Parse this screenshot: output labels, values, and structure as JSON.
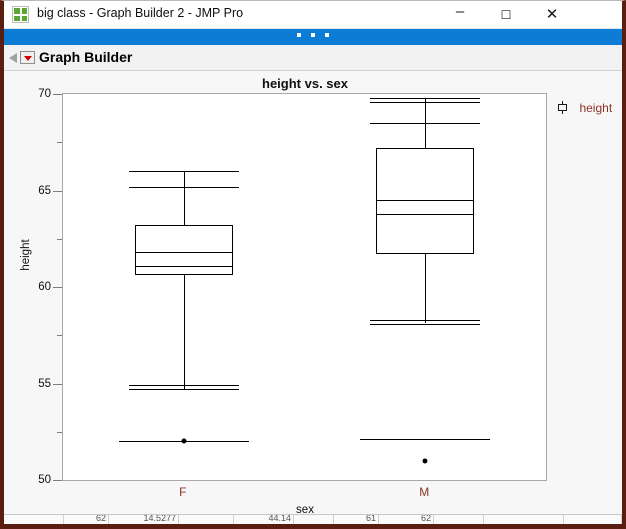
{
  "window": {
    "title": "big class - Graph Builder 2 - JMP Pro",
    "app_icon": "jmp-grid-icon",
    "minimize_label": "–",
    "maximize_label": "☐",
    "close_label": "✕"
  },
  "toolbar": {
    "handle_label": "toolbar-handle-dots"
  },
  "report": {
    "title": "Graph Builder",
    "menu_icon": "red-triangle-menu-icon",
    "disclosure_icon": "disclosure-triangle-icon"
  },
  "legend": {
    "label": "height",
    "icon": "boxplot-legend-icon",
    "color": "#8a3324"
  },
  "colors": {
    "axis_label": "#8a3324",
    "frame": "#a8a8a8",
    "titlebar_accent": "#0c7cd5",
    "window_border": "#5a1e10",
    "plot_background": "#ffffff"
  },
  "bottom_table": {
    "cells": [
      "",
      "62",
      "14.5277",
      "",
      "44.14",
      "",
      "61",
      "62",
      "",
      "",
      ""
    ]
  },
  "chart_data": {
    "type": "box",
    "title": "height vs. sex",
    "xlabel": "sex",
    "ylabel": "height",
    "ylim": [
      50,
      70
    ],
    "ytick_major": [
      50,
      55,
      60,
      65,
      70
    ],
    "ytick_minor": [
      52.5,
      57.5,
      62.5,
      67.5
    ],
    "categories": [
      "F",
      "M"
    ],
    "grid": false,
    "legend_position": "right",
    "series": [
      {
        "name": "F",
        "category": "F",
        "min": 51.9,
        "lower_whisker_cap": 54.9,
        "lower_whisker_cap2": 54.7,
        "q1": 60.6,
        "median": 61.6,
        "median_band_low": 61.1,
        "median_band_high": 61.8,
        "q3": 63.2,
        "upper_whisker_cap": 65.2,
        "max": 66.0,
        "outliers": [
          52.0
        ],
        "outlier_line": 52.0
      },
      {
        "name": "M",
        "category": "M",
        "min": 51.0,
        "lower_whisker_cap": 58.3,
        "lower_whisker_cap2": 58.1,
        "q1": 61.7,
        "median": 64.0,
        "median_band_low": 63.8,
        "median_band_high": 64.5,
        "q3": 67.2,
        "upper_whisker_cap": 68.5,
        "max": 69.8,
        "max2": 69.6,
        "outliers": [
          51.0
        ],
        "outlier_line": 52.1
      }
    ]
  }
}
